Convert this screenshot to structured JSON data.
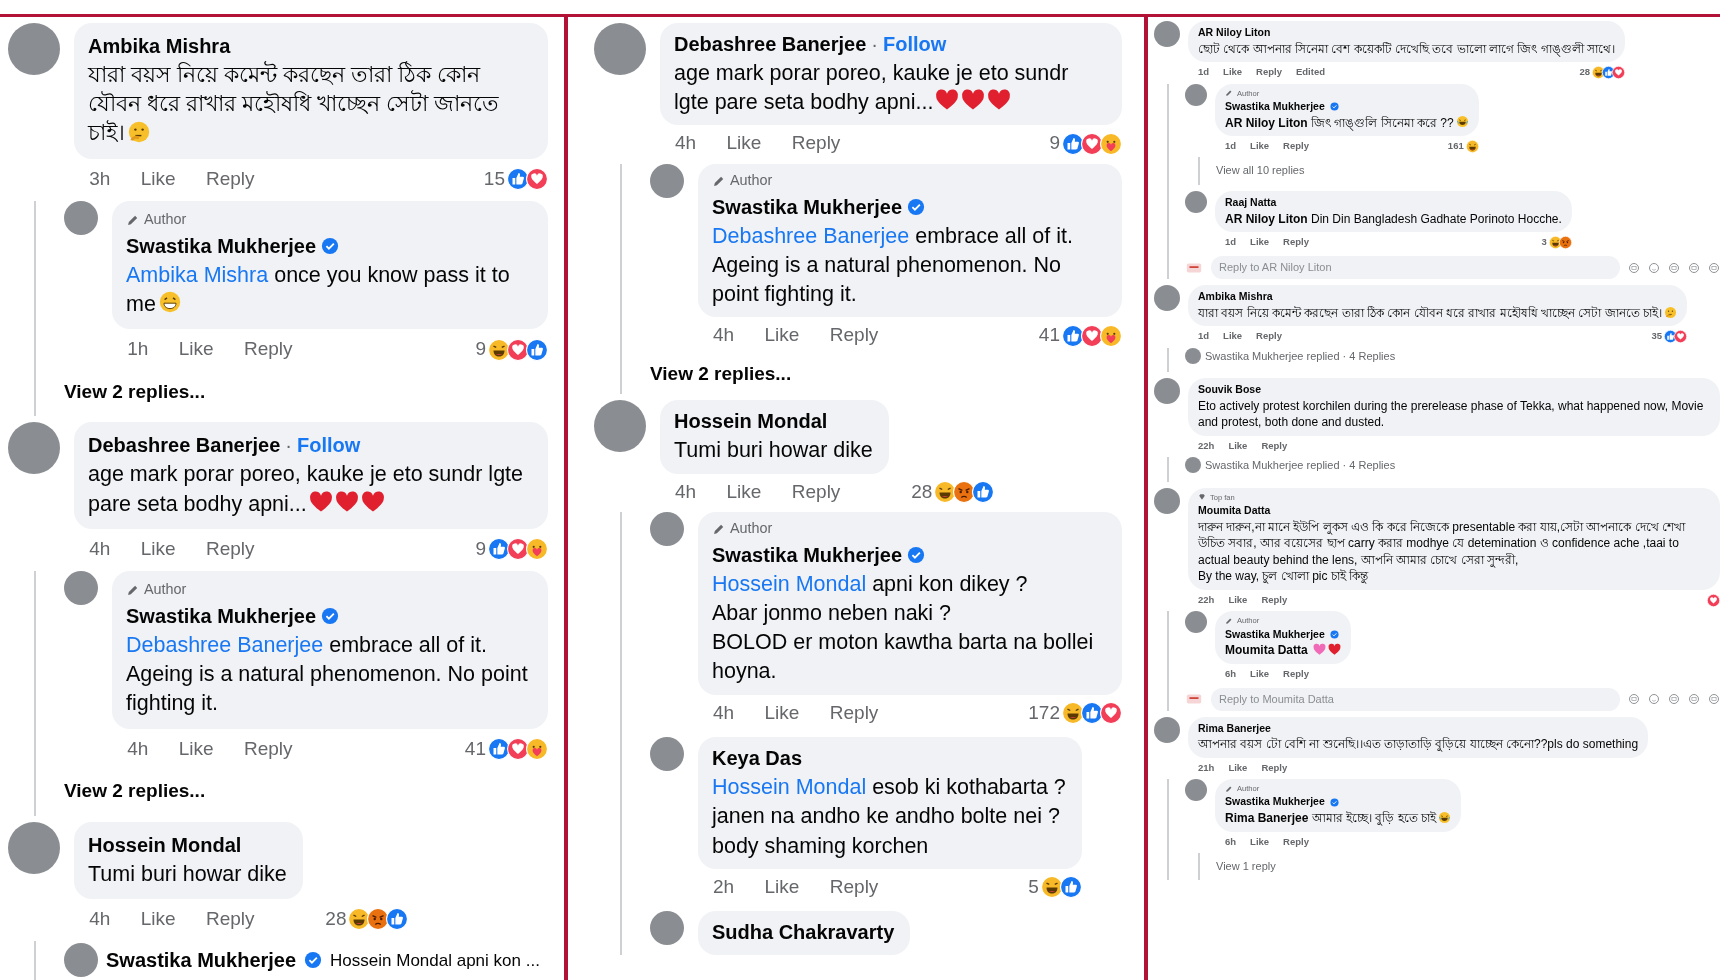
{
  "panels": [
    {
      "kind": "large",
      "items": [
        {
          "kind": "comment",
          "author": "Ambika Mishra",
          "text": "যারা বয়স নিয়ে কমেন্ট করছেন তারা ঠিক কোন যৌবন ধরে রাখার মহৌষধি খাচ্ছেন সেটা জানতে চাই।",
          "emojis": [
            {
              "kind": "thinking"
            }
          ],
          "time": "3h",
          "like": "Like",
          "reply": "Reply",
          "count": "15",
          "reactions": [
            {
              "kind": "like"
            },
            {
              "kind": "love"
            }
          ],
          "children": [
            {
              "kind": "comment",
              "badge": {
                "kind": "author",
                "label": "Author"
              },
              "author": "Swastika Mukherjee",
              "verified": true,
              "mention": "Ambika Mishra",
              "text": "once you know pass it to me",
              "emojis": [
                {
                  "kind": "grin"
                }
              ],
              "time": "1h",
              "like": "Like",
              "reply": "Reply",
              "count": "9",
              "reactions": [
                {
                  "kind": "haha"
                },
                {
                  "kind": "love"
                },
                {
                  "kind": "like"
                }
              ]
            },
            {
              "kind": "view_replies",
              "label": "View 2 replies..."
            }
          ]
        },
        {
          "kind": "comment",
          "author": "Debashree Banerjee",
          "follow_separator": "·",
          "follow": "Follow",
          "text": "age mark porar poreo, kauke je eto sundr lgte pare seta bodhy apni...",
          "emojis": [
            {
              "kind": "heart"
            },
            {
              "kind": "heart"
            },
            {
              "kind": "heart"
            }
          ],
          "time": "4h",
          "like": "Like",
          "reply": "Reply",
          "count": "9",
          "reactions": [
            {
              "kind": "like"
            },
            {
              "kind": "love"
            },
            {
              "kind": "care"
            }
          ],
          "children": [
            {
              "kind": "comment",
              "badge": {
                "kind": "author",
                "label": "Author"
              },
              "author": "Swastika Mukherjee",
              "verified": true,
              "mention": "Debashree Banerjee",
              "text": "embrace all of it. Ageing is a natural phenomenon. No point fighting it.",
              "time": "4h",
              "like": "Like",
              "reply": "Reply",
              "count": "41",
              "reactions": [
                {
                  "kind": "like"
                },
                {
                  "kind": "love"
                },
                {
                  "kind": "care"
                }
              ]
            },
            {
              "kind": "view_replies",
              "label": "View 2 replies..."
            }
          ]
        },
        {
          "kind": "comment",
          "author": "Hossein Mondal",
          "text": "Tumi buri howar dike",
          "time": "4h",
          "like": "Like",
          "reply": "Reply",
          "count": "28",
          "reactions": [
            {
              "kind": "haha"
            },
            {
              "kind": "angry"
            },
            {
              "kind": "like"
            }
          ],
          "children": [
            {
              "kind": "collapsed_reply",
              "author": "Swastika Mukherjee",
              "verified": true,
              "preview": "Hossein Mondal apni kon ..."
            }
          ]
        }
      ]
    },
    {
      "kind": "large",
      "items": [
        {
          "kind": "comment",
          "author": "Debashree Banerjee",
          "follow_separator": "·",
          "follow": "Follow",
          "text": "age mark porar poreo, kauke je eto sundr lgte pare seta bodhy apni...",
          "emojis": [
            {
              "kind": "heart"
            },
            {
              "kind": "heart"
            },
            {
              "kind": "heart"
            }
          ],
          "time": "4h",
          "like": "Like",
          "reply": "Reply",
          "count": "9",
          "reactions": [
            {
              "kind": "like"
            },
            {
              "kind": "love"
            },
            {
              "kind": "care"
            }
          ],
          "children": [
            {
              "kind": "comment",
              "badge": {
                "kind": "author",
                "label": "Author"
              },
              "author": "Swastika Mukherjee",
              "verified": true,
              "mention": "Debashree Banerjee",
              "text": "embrace all of it. Ageing is a natural phenomenon. No point fighting it.",
              "time": "4h",
              "like": "Like",
              "reply": "Reply",
              "count": "41",
              "reactions": [
                {
                  "kind": "like"
                },
                {
                  "kind": "love"
                },
                {
                  "kind": "care"
                }
              ]
            },
            {
              "kind": "view_replies",
              "label": "View 2 replies..."
            }
          ]
        },
        {
          "kind": "comment",
          "author": "Hossein Mondal",
          "text": "Tumi buri howar dike",
          "time": "4h",
          "like": "Like",
          "reply": "Reply",
          "count": "28",
          "reactions": [
            {
              "kind": "haha"
            },
            {
              "kind": "angry"
            },
            {
              "kind": "like"
            }
          ],
          "children": [
            {
              "kind": "comment",
              "badge": {
                "kind": "author",
                "label": "Author"
              },
              "author": "Swastika Mukherjee",
              "verified": true,
              "mention": "Hossein Mondal",
              "text": "apni kon dikey ?\nAbar jonmo neben naki ?\nBOLOD er moton kawtha barta na bollei hoyna.",
              "time": "4h",
              "like": "Like",
              "reply": "Reply",
              "count": "172",
              "reactions": [
                {
                  "kind": "haha"
                },
                {
                  "kind": "like"
                },
                {
                  "kind": "love"
                }
              ]
            },
            {
              "kind": "comment",
              "author": "Keya Das",
              "mention": "Hossein Mondal",
              "text": "esob ki kothabarta ?\njanen na andho ke andho bolte nei ?\nbody shaming korchen",
              "time": "2h",
              "like": "Like",
              "reply": "Reply",
              "count": "5",
              "reactions": [
                {
                  "kind": "haha"
                },
                {
                  "kind": "like"
                }
              ]
            },
            {
              "kind": "comment",
              "author": "Sudha Chakravarty"
            }
          ]
        }
      ]
    },
    {
      "kind": "small",
      "items": [
        {
          "kind": "comment",
          "author": "AR Niloy Liton",
          "text": "ছোট থেকে আপনার সিনেমা বেশ কয়েকটি দেখেছি তবে ভালো লাগে জিৎ গাঙ্গুলী সাথে।",
          "time": "1d",
          "like": "Like",
          "reply": "Reply",
          "edited": "Edited",
          "count": "28",
          "reactions": [
            {
              "kind": "haha"
            },
            {
              "kind": "like"
            },
            {
              "kind": "love"
            }
          ],
          "children": [
            {
              "kind": "comment",
              "badge": {
                "kind": "author",
                "label": "Author"
              },
              "author": "Swastika Mukherjee",
              "verified": true,
              "mention": "AR Niloy Liton",
              "text": "জিৎ গাঙ্গুলি সিনেমা করে ??",
              "emojis": [
                {
                  "kind": "laugh"
                }
              ],
              "time": "1d",
              "like": "Like",
              "reply": "Reply",
              "count": "161",
              "reactions": [
                {
                  "kind": "haha"
                }
              ],
              "children": [
                {
                  "kind": "view_replies",
                  "label": "View all 10 replies"
                }
              ]
            },
            {
              "kind": "comment",
              "author": "Raaj Natta",
              "mention": "AR Niloy Liton",
              "text": "Din Din Bangladesh Gadhate Porinoto Hocche.",
              "time": "1d",
              "like": "Like",
              "reply": "Reply",
              "count": "3",
              "reactions": [
                {
                  "kind": "haha"
                },
                {
                  "kind": "angry"
                }
              ]
            },
            {
              "kind": "reply_box",
              "placeholder": "Reply to AR Niloy Liton"
            }
          ]
        },
        {
          "kind": "comment",
          "author": "Ambika Mishra",
          "text": "যারা বয়স নিয়ে কমেন্ট করছেন তারা ঠিক কোন যৌবন ধরে রাখার মহৌষধি খাচ্ছেন সেটা জানতে চাই।",
          "emojis": [
            {
              "kind": "thinking"
            }
          ],
          "time": "1d",
          "like": "Like",
          "reply": "Reply",
          "count": "35",
          "reactions": [
            {
              "kind": "like"
            },
            {
              "kind": "love"
            }
          ],
          "children": [
            {
              "kind": "replies_summary",
              "label": "Swastika Mukherjee replied · 4 Replies"
            }
          ]
        },
        {
          "kind": "comment",
          "author": "Souvik Bose",
          "text": "Eto actively protest korchilen during the prerelease phase of Tekka, what happened now, Movie and protest, both done and dusted.",
          "time": "22h",
          "like": "Like",
          "reply": "Reply",
          "children": [
            {
              "kind": "replies_summary",
              "label": "Swastika Mukherjee replied · 4 Replies"
            }
          ]
        },
        {
          "kind": "comment",
          "badge": {
            "kind": "top_fan",
            "label": "Top fan"
          },
          "author": "Moumita Datta",
          "text": "দারুন দারুন,না মানে ইউপি লুকস এও কি করে নিজেকে presentable করা যায়,সেটা আপনাকে দেখে শেখা উচিত সবার, আর বয়েসের ছাপ carry করার modhye যে detemination ও confidence ache ,taai to actual beauty behind the lens, আপনি আমার চোখে সেরা সুন্দরী,\nBy the way, চুল খোলা pic চাই কিন্তু",
          "time": "22h",
          "like": "Like",
          "reply": "Reply",
          "reactions": [
            {
              "kind": "love"
            }
          ],
          "children": [
            {
              "kind": "comment",
              "badge": {
                "kind": "author",
                "label": "Author"
              },
              "author": "Swastika Mukherjee",
              "verified": true,
              "mention": "Moumita Datta",
              "emojis": [
                {
                  "kind": "pink_heart"
                },
                {
                  "kind": "heart"
                }
              ],
              "time": "6h",
              "like": "Like",
              "reply": "Reply"
            },
            {
              "kind": "reply_box",
              "placeholder": "Reply to Moumita Datta"
            }
          ]
        },
        {
          "kind": "comment",
          "author": "Rima Banerjee",
          "text": "আপনার বয়স টো বেশি না শুনেছি।।এত তাড়াতাড়ি বুড়িয়ে যাচ্ছেন কেনো??pls do something",
          "time": "21h",
          "like": "Like",
          "reply": "Reply",
          "children": [
            {
              "kind": "comment",
              "badge": {
                "kind": "author",
                "label": "Author"
              },
              "author": "Swastika Mukherjee",
              "verified": true,
              "mention": "Rima Banerjee",
              "text": "আমার ইচ্ছে। বুড়ি হতে চাই",
              "emojis": [
                {
                  "kind": "laugh"
                }
              ],
              "time": "6h",
              "like": "Like",
              "reply": "Reply",
              "children": [
                {
                  "kind": "view_replies",
                  "label": "View 1 reply"
                }
              ]
            }
          ]
        }
      ]
    }
  ]
}
